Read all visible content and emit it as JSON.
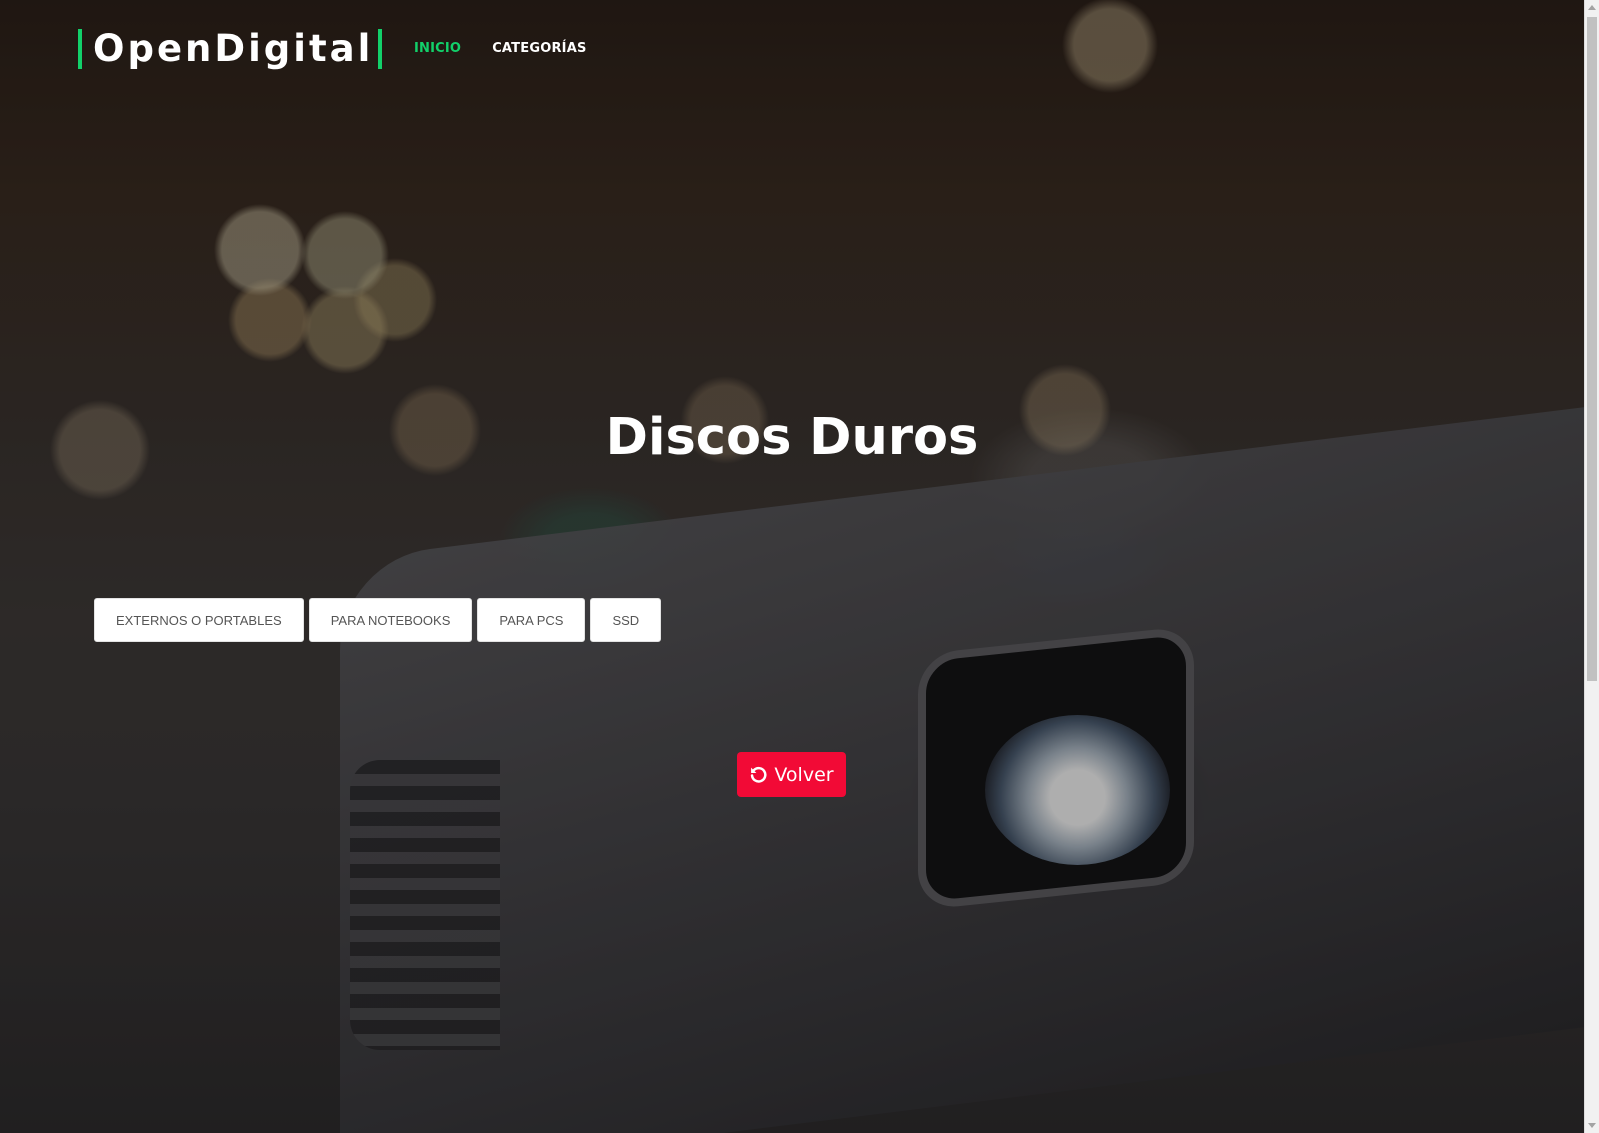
{
  "brand": {
    "name": "OpenDigital",
    "accent_color": "#12d06a"
  },
  "nav": {
    "items": [
      {
        "label": "INICIO",
        "active": true
      },
      {
        "label": "CATEGORÍAS",
        "active": false
      }
    ]
  },
  "hero": {
    "title": "Discos Duros",
    "background": "blurred-projector-photo"
  },
  "categories": [
    {
      "label": "EXTERNOS O PORTABLES"
    },
    {
      "label": "PARA NOTEBOOKS"
    },
    {
      "label": "PARA PCS"
    },
    {
      "label": "SSD"
    }
  ],
  "back_button": {
    "label": "Volver",
    "icon": "undo-icon",
    "color": "#f20a36"
  }
}
